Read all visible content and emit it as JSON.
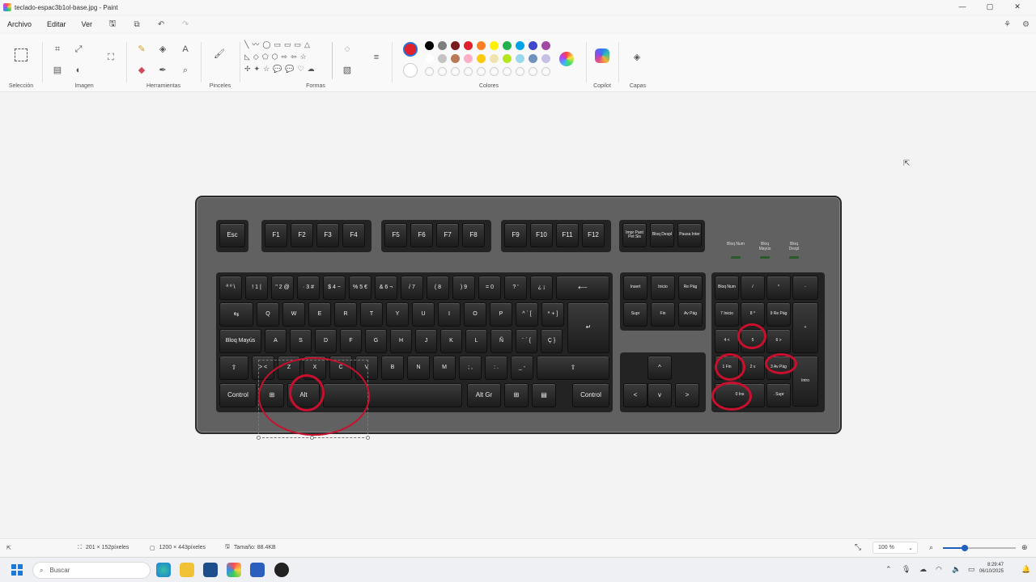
{
  "window": {
    "title": "teclado-espac3b1ol-base.jpg - Paint",
    "controls": [
      "—",
      "▢",
      "✕"
    ]
  },
  "menu": {
    "items": [
      "Archivo",
      "Editar",
      "Ver"
    ],
    "quick_icons": [
      "save-icon",
      "share-icon",
      "undo-icon",
      "redo-icon"
    ]
  },
  "ribbon": {
    "groups": {
      "seleccion": "Selección",
      "imagen": "Imagen",
      "herramientas": "Herramientas",
      "pinceles": "Pinceles",
      "formas": "Formas",
      "colores": "Colores",
      "copilot": "Copilot",
      "capas": "Capas"
    },
    "text_tool": "A",
    "colors": {
      "primary": "#e0202a",
      "palette_row1": [
        "#000000",
        "#7f7f7f",
        "#7a1a1a",
        "#e0202a",
        "#ff7f27",
        "#fff200",
        "#22b14c",
        "#00a2e8",
        "#3f48cc",
        "#a349a4"
      ],
      "palette_row2": [
        "#ffffff",
        "#c3c3c3",
        "#b97a57",
        "#ffaec9",
        "#ffc90e",
        "#efe4b0",
        "#b5e61d",
        "#99d9ea",
        "#7092be",
        "#c8bfe7"
      ]
    }
  },
  "keyboard": {
    "function_row": [
      "Esc",
      "F1",
      "F2",
      "F3",
      "F4",
      "F5",
      "F6",
      "F7",
      "F8",
      "F9",
      "F10",
      "F11",
      "F12"
    ],
    "system_keys": [
      "Impr Pant Pet Sis",
      "Bloq Despl",
      "Pausa Inter"
    ],
    "leds": [
      "Bloq Num",
      "Bloq Mayús",
      "Bloq Despl"
    ],
    "row1": [
      "ª º \\",
      "! 1 |",
      "\" 2 @",
      "· 3 #",
      "$ 4 ~",
      "% 5 €",
      "& 6 ¬",
      "/ 7",
      "( 8",
      ") 9",
      "= 0",
      "? '",
      "¿ ¡",
      "⟵"
    ],
    "row2": [
      "⇆",
      "Q",
      "W",
      "E",
      "R",
      "T",
      "Y",
      "U",
      "I",
      "O",
      "P",
      "^ ` [",
      "* + ]",
      "↵"
    ],
    "row3": [
      "Bloq Mayús",
      "A",
      "S",
      "D",
      "F",
      "G",
      "H",
      "J",
      "K",
      "L",
      "Ñ",
      "¨ ´ {",
      "Ç }"
    ],
    "row4": [
      "⇧",
      "> <",
      "Z",
      "X",
      "C",
      "V",
      "B",
      "N",
      "M",
      "; ,",
      ": .",
      "_ -",
      "⇧"
    ],
    "row5": [
      "Control",
      "⊞",
      "Alt",
      "",
      "Alt Gr",
      "⊞",
      "▤",
      "Control"
    ],
    "nav_top": [
      "Insert",
      "Inicio",
      "Re Pág",
      "Supr",
      "Fin",
      "Av Pág"
    ],
    "arrows": [
      "^",
      "<",
      "v",
      ">"
    ],
    "numpad": [
      "Bloq Num",
      "/",
      "*",
      "-",
      "7 Inicio",
      "8 ^",
      "9 Re Pág",
      "+",
      "4 <",
      "5",
      "6 >",
      "1 Fin",
      "2 v",
      "3 Av Pág",
      "Intro",
      "0 Ins",
      ". Supr"
    ]
  },
  "status": {
    "selection_size": "201 × 152píxeles",
    "image_size": "1200 × 443píxeles",
    "file_size": "Tamaño: 88.4KB",
    "zoom": "100 %",
    "zoom_level_percent": 30
  },
  "taskbar": {
    "search_placeholder": "Buscar",
    "time": "8:29:47",
    "date": "06/10/2025"
  }
}
